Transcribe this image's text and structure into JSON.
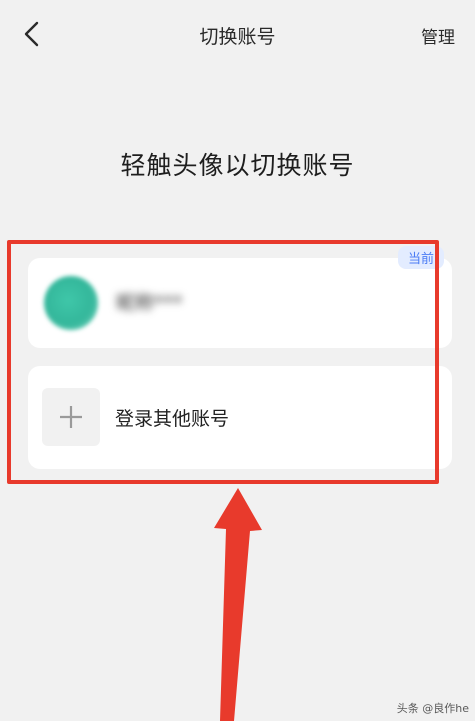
{
  "header": {
    "title": "切换账号",
    "manage_label": "管理",
    "back_icon": "chevron-left-icon"
  },
  "hint": "轻触头像以切换账号",
  "accounts": [
    {
      "name": "昵称*** ",
      "badge": "当前",
      "avatar_color": "#3fc7a9",
      "blurred": true
    }
  ],
  "add_account": {
    "label": "登录其他账号",
    "icon": "plus-icon"
  },
  "annotation": {
    "frame_color": "#e83a2c",
    "arrow_color": "#e83a2c"
  },
  "watermark": "头条 @良作he"
}
